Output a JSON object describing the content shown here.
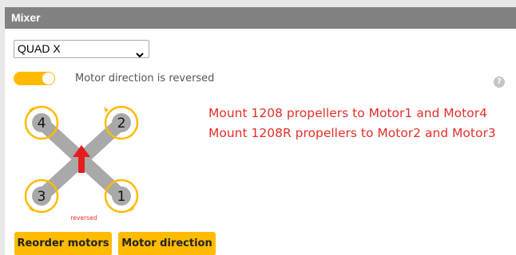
{
  "panel": {
    "title": "Mixer"
  },
  "mixer_select": {
    "value": "QUAD X",
    "icon": "chevron-down-icon"
  },
  "motor_direction_toggle": {
    "label": "Motor direction is reversed",
    "on": true
  },
  "help": {
    "icon": "help-icon",
    "symbol": "?"
  },
  "diagram": {
    "motors": [
      {
        "position": "top-left",
        "label": "4"
      },
      {
        "position": "top-right",
        "label": "2"
      },
      {
        "position": "bottom-left",
        "label": "3"
      },
      {
        "position": "bottom-right",
        "label": "1"
      }
    ],
    "reversed_label": "reversed",
    "icon": "forward-arrow-icon"
  },
  "notes": [
    "Mount 1208 propellers to Motor1 and Motor4",
    "Mount 1208R propellers to Motor2 and Motor3"
  ],
  "buttons": {
    "reorder": "Reorder motors",
    "direction": "Motor direction"
  },
  "colors": {
    "accent": "#ffbb00",
    "header": "#828282",
    "note": "#e5302a",
    "arrow": "#e41e1e"
  }
}
